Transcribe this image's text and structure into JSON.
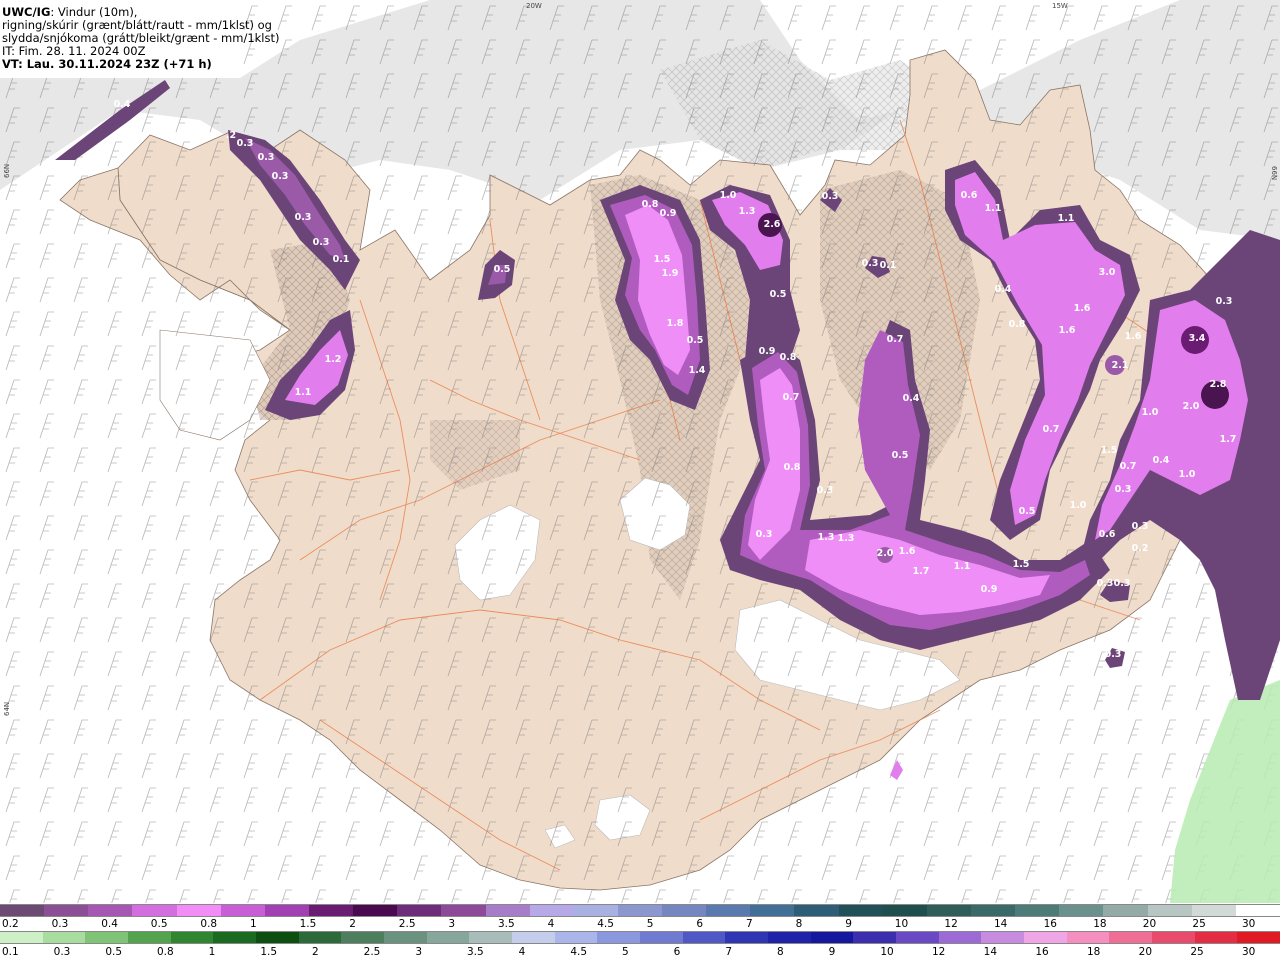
{
  "header": {
    "title_bold": "UWC/IG",
    "title_rest": ": Vindur (10m),",
    "line2": "rigning/skúrir (grænt/blátt/rautt - mm/1klst) og",
    "line3": "slydda/snjókoma (grátt/bleikt/grænt - mm/1klst)",
    "it": "IT: Fim. 28. 11. 2024 00Z",
    "vt": "VT: Lau. 30.11.2024 23Z (+71 h)"
  },
  "grid_labels": {
    "lon_20w": "20W",
    "lon_15w": "15W",
    "lat_66n": "66N",
    "lat_64n": "64N",
    "lat_66n_right": "66N"
  },
  "colors": {
    "land": "#f0dccb",
    "sea": "#ffffff",
    "cloud_gray": "#e6e6e6",
    "snow_dark": "#6b4478",
    "snow_mid": "#b05cbf",
    "snow_light": "#e27ded",
    "snow_bright": "#f08ef7",
    "snow_core": "#4a1450",
    "rain_green": "#b6ebb0",
    "glacier": "#ffffff",
    "roads": "#e8743a"
  },
  "precip_labels": [
    {
      "text": "0.4"
    },
    {
      "text": ".2"
    },
    {
      "text": "0.3"
    },
    {
      "text": "0.3"
    },
    {
      "text": "0.3"
    },
    {
      "text": "0.3"
    },
    {
      "text": "0.3"
    },
    {
      "text": "0.1"
    },
    {
      "text": "1.2"
    },
    {
      "text": "1.1"
    },
    {
      "text": "0.5"
    },
    {
      "text": "0.8"
    },
    {
      "text": "0.9"
    },
    {
      "text": "1.5"
    },
    {
      "text": "1.9"
    },
    {
      "text": "1.8"
    },
    {
      "text": "0.5"
    },
    {
      "text": "1.4"
    },
    {
      "text": "1.0"
    },
    {
      "text": "1.3"
    },
    {
      "text": "2.6"
    },
    {
      "text": "0.5"
    },
    {
      "text": "0.9"
    },
    {
      "text": "0.8"
    },
    {
      "text": "0.7"
    },
    {
      "text": "0.8"
    },
    {
      "text": "0.3"
    },
    {
      "text": "0.3"
    },
    {
      "text": "0.3"
    },
    {
      "text": "0.1"
    },
    {
      "text": "0.7"
    },
    {
      "text": "0.4"
    },
    {
      "text": "0.5"
    },
    {
      "text": "0.6"
    },
    {
      "text": "1.1"
    },
    {
      "text": "1.1"
    },
    {
      "text": "0.4"
    },
    {
      "text": "0.8"
    },
    {
      "text": "1.6"
    },
    {
      "text": "1.6"
    },
    {
      "text": "3.0"
    },
    {
      "text": "1.6"
    },
    {
      "text": "2.1"
    },
    {
      "text": "3.4"
    },
    {
      "text": "0.3"
    },
    {
      "text": "2.8"
    },
    {
      "text": "2.0"
    },
    {
      "text": "1.0"
    },
    {
      "text": "0.7"
    },
    {
      "text": "1.5"
    },
    {
      "text": "0.7"
    },
    {
      "text": "0.4"
    },
    {
      "text": "1.7"
    },
    {
      "text": "1.0"
    },
    {
      "text": "0.3"
    },
    {
      "text": "1.0"
    },
    {
      "text": "0.5"
    },
    {
      "text": "0.6"
    },
    {
      "text": "0.2"
    },
    {
      "text": "0.3"
    },
    {
      "text": "0.3"
    },
    {
      "text": "0.3"
    },
    {
      "text": "0.3"
    },
    {
      "text": "1.3"
    },
    {
      "text": "1.3"
    },
    {
      "text": "2.0"
    },
    {
      "text": "1.6"
    },
    {
      "text": "1.7"
    },
    {
      "text": "1.1"
    },
    {
      "text": "0.9"
    },
    {
      "text": "1.5"
    },
    {
      "text": "0.3"
    }
  ],
  "legend": {
    "snow_colors": [
      "#6b4a73",
      "#8b4f96",
      "#a557b3",
      "#d36ee0",
      "#f28cf7",
      "#c85fd6",
      "#a23fb3",
      "#6a1c72",
      "#4a0a50",
      "#6e2d7a",
      "#8c4a99",
      "#a77cc8",
      "#b7a8e8",
      "#a9b1e3",
      "#8d97cf",
      "#7686c0",
      "#5a79ae",
      "#436f97",
      "#2f5d78",
      "#215058",
      "#1f4f4c",
      "#2e5d5a",
      "#3a6a67",
      "#4d7b77",
      "#6b918c",
      "#93aaa6",
      "#b7c6c3",
      "#d2dad8",
      "#ffffff"
    ],
    "snow_labels": [
      "0.2",
      "0.3",
      "0.4",
      "0.5",
      "0.8",
      "1",
      "1.5",
      "2",
      "2.5",
      "3",
      "3.5",
      "4",
      "4.5",
      "5",
      "6",
      "7",
      "8",
      "9",
      "10",
      "12",
      "14",
      "16",
      "18",
      "20",
      "25",
      "30"
    ],
    "rain_colors": [
      "#cdf0c6",
      "#a9dd9f",
      "#7fc377",
      "#54a34e",
      "#2f8530",
      "#1a6b1f",
      "#0c4f10",
      "#2c6a3a",
      "#4d7f5f",
      "#6a927e",
      "#88a79c",
      "#a8bdb9",
      "#c4cdea",
      "#aab5ea",
      "#8c98dd",
      "#6f7ad0",
      "#4f58c4",
      "#2e36b3",
      "#1e23a8",
      "#15189c",
      "#3b2fb0",
      "#6a49c4",
      "#9b6ad4",
      "#c78ce0",
      "#f0a6e6",
      "#f48fc0",
      "#ef6e96",
      "#e84b6c",
      "#e22d43",
      "#e01a25"
    ],
    "rain_labels": [
      "0.1",
      "0.3",
      "0.5",
      "0.8",
      "1",
      "1.5",
      "2",
      "2.5",
      "3",
      "3.5",
      "4",
      "4.5",
      "5",
      "6",
      "7",
      "8",
      "9",
      "10",
      "12",
      "14",
      "16",
      "18",
      "20",
      "25",
      "30"
    ]
  }
}
